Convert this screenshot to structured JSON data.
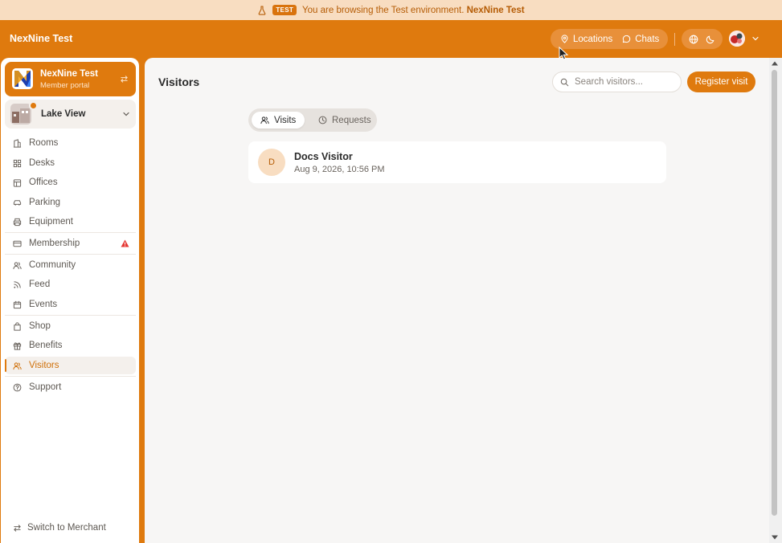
{
  "banner": {
    "badge": "TEST",
    "message": "You are browsing the Test environment.",
    "environment_name": "NexNine Test",
    "text_color": "#b55c05",
    "background": "#f8ddc1"
  },
  "topbar": {
    "brand": "NexNine Test",
    "locations_label": "Locations",
    "chats_label": "Chats",
    "icons": [
      "map-pin-icon",
      "chat-bubble-icon",
      "globe-icon",
      "moon-icon",
      "chevron-down-icon"
    ],
    "accent": "#df7a0e"
  },
  "sidebar": {
    "org": {
      "name": "NexNine Test",
      "subtitle": "Member portal"
    },
    "location": {
      "name": "Lake View"
    },
    "items": [
      {
        "label": "Rooms",
        "icon": "building-icon"
      },
      {
        "label": "Desks",
        "icon": "grid-icon"
      },
      {
        "label": "Offices",
        "icon": "offices-icon"
      },
      {
        "label": "Parking",
        "icon": "car-icon"
      },
      {
        "label": "Equipment",
        "icon": "printer-icon"
      },
      {
        "label": "Membership",
        "icon": "card-icon",
        "warning": true
      },
      {
        "label": "Community",
        "icon": "users-icon"
      },
      {
        "label": "Feed",
        "icon": "rss-icon"
      },
      {
        "label": "Events",
        "icon": "calendar-icon"
      },
      {
        "label": "Shop",
        "icon": "bag-icon"
      },
      {
        "label": "Benefits",
        "icon": "gift-icon"
      },
      {
        "label": "Visitors",
        "icon": "visitors-icon",
        "active": true
      },
      {
        "label": "Support",
        "icon": "help-icon"
      }
    ],
    "switch_merchant": "Switch to Merchant",
    "warning_color": "#e53935"
  },
  "main": {
    "title": "Visitors",
    "search": {
      "placeholder": "Search visitors...",
      "value": ""
    },
    "register_label": "Register visit",
    "tabs": [
      {
        "label": "Visits",
        "active": true
      },
      {
        "label": "Requests",
        "active": false
      }
    ],
    "visits": [
      {
        "initial": "D",
        "name": "Docs Visitor",
        "time": "Aug 9, 2026, 10:56 PM"
      }
    ]
  }
}
